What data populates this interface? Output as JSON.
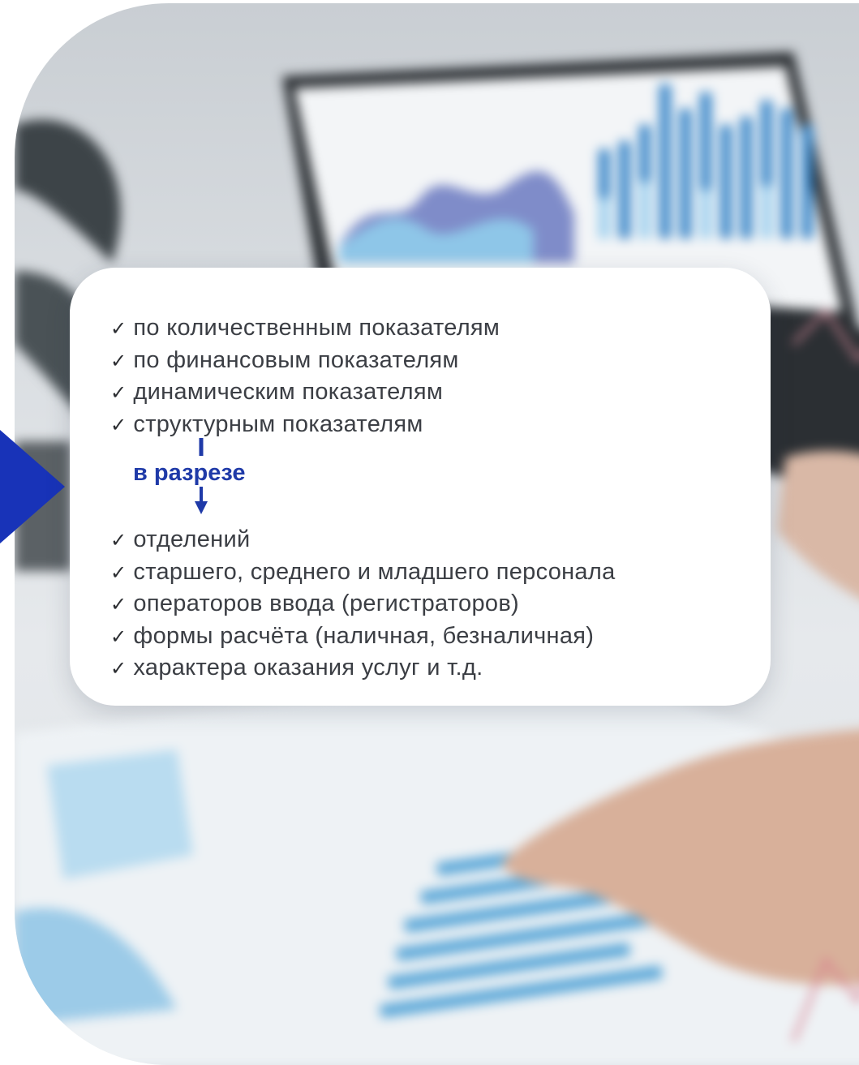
{
  "card": {
    "primary_items": [
      "по количественным показателям",
      "по финансовым показателям",
      "динамическим показателям",
      "структурным показателям"
    ],
    "connector_label": "в разрезе",
    "secondary_items": [
      "отделений",
      "старшего, среднего и младшего персонала",
      "операторов ввода (регистраторов)",
      "формы расчёта (наличная, безналичная)",
      "характера оказания услуг и т.д."
    ],
    "check_glyph": "✓"
  },
  "colors": {
    "accent": "#1f3aa8",
    "marker": "#1833b8",
    "text": "#3b3e44"
  },
  "icons": {
    "marker": "triangle-right-icon",
    "item": "checkmark-icon",
    "connector": "arrow-down-icon"
  }
}
